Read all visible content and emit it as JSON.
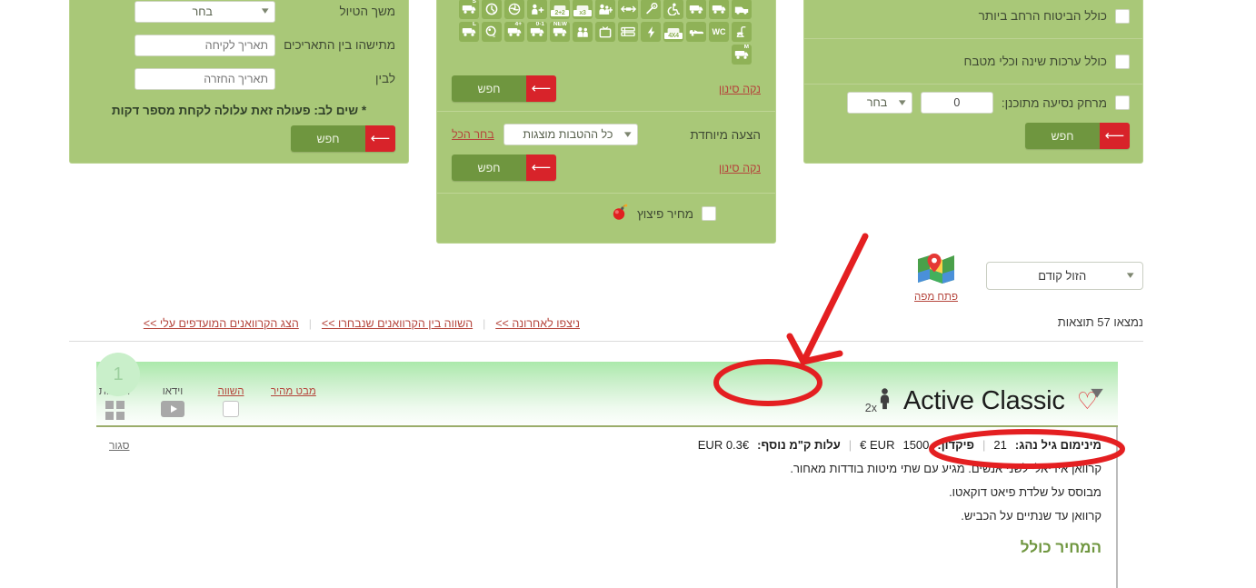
{
  "filters_left": {
    "rows": [
      {
        "label": "משך הטיול",
        "type": "select",
        "value": "בחר"
      },
      {
        "label": "מתישהו בין התאריכים",
        "type": "text",
        "placeholder": "תאריך לקיחה",
        "value": ""
      },
      {
        "label": "לבין",
        "type": "text",
        "placeholder": "תאריך החזרה",
        "value": ""
      }
    ],
    "note": "* שים לב: פעולה זאת עלולה לקחת מספר דקות",
    "search_label": "חפש"
  },
  "filters_mid": {
    "icons": [
      {
        "name": "van-icon",
        "glyph": "van"
      },
      {
        "name": "camper-icon",
        "glyph": "camper"
      },
      {
        "name": "motorhome-icon",
        "glyph": "camper"
      },
      {
        "name": "wheelchair-accessible-icon",
        "glyph": "wheelchair"
      },
      {
        "name": "automatic-transmission-icon",
        "glyph": "key-a"
      },
      {
        "name": "length-icon",
        "glyph": "arrows"
      },
      {
        "name": "family-plus-icon",
        "glyph": "family"
      },
      {
        "name": "capacity-3-icon",
        "glyph": "tag",
        "tag": "x3"
      },
      {
        "name": "capacity-2plus2-icon",
        "glyph": "tag",
        "tag": "2+2"
      },
      {
        "name": "pet-friendly-icon",
        "glyph": "pet"
      },
      {
        "name": "aircon-icon",
        "glyph": "fan"
      },
      {
        "name": "year-icon",
        "glyph": "year"
      },
      {
        "name": "camper-s-icon",
        "glyph": "camper",
        "sup": "S"
      },
      {
        "name": "shower-icon",
        "glyph": "shower"
      },
      {
        "name": "toilet-icon",
        "glyph": "wc"
      },
      {
        "name": "bed-van-icon",
        "glyph": "bedvan"
      },
      {
        "name": "four-by-four-icon",
        "glyph": "tag",
        "tag": "4X4"
      },
      {
        "name": "electricity-icon",
        "glyph": "bolt"
      },
      {
        "name": "bunk-bed-icon",
        "glyph": "bunk"
      },
      {
        "name": "tv-icon",
        "glyph": "tv"
      },
      {
        "name": "children-icon",
        "glyph": "kids"
      },
      {
        "name": "new-camper-icon",
        "glyph": "camper",
        "sup": "NEW"
      },
      {
        "name": "camper-0-1-icon",
        "glyph": "camper",
        "sup": "0-1"
      },
      {
        "name": "camper-plus4-icon",
        "glyph": "camper",
        "sup": "+4"
      },
      {
        "name": "celsius-icon",
        "glyph": "celsius"
      },
      {
        "name": "camper-l-icon",
        "glyph": "camper",
        "sup": "L"
      },
      {
        "name": "camper-m-icon",
        "glyph": "camper",
        "sup": "M"
      }
    ],
    "clear_filter_1": "נקה סינון",
    "search_label_1": "חפש",
    "special_offer_label": "הצעה מיוחדת",
    "offers_select_value": "כל ההטבות מוצגות",
    "select_all": "בחר הכל",
    "clear_filter_2": "נקה סינון",
    "search_label_2": "חפש",
    "blowout_price_label": "מחיר פיצוץ"
  },
  "filters_right": {
    "rows": [
      {
        "label": "כולל הביטוח הרחב ביותר"
      },
      {
        "label": "כולל ערכות שינה וכלי מטבח"
      }
    ],
    "distance_label": "מרחק נסיעה מתוכנן:",
    "distance_value": "0",
    "distance_unit": "בחר",
    "search_label": "חפש"
  },
  "toolbar": {
    "sort_value": "הזול קודם",
    "map_label": "פתח מפה",
    "results_count": "נמצאו 57 תוצאות",
    "links": [
      "ניצפו לאחרונה >>",
      "השווה בין הקרוואנים שנבחרו >>",
      "הצג הקרוואנים המועדפים עלי >>"
    ]
  },
  "result_card": {
    "badge": "1",
    "name": "Active Classic",
    "sleeps": "2x",
    "quick_view": "מבט מהיר",
    "compare": "השווה",
    "video": "וידאו",
    "photos": "תמונות",
    "close_link": "סגור",
    "specs": {
      "min_age_label": "מינימום גיל נהג:",
      "min_age_value": "21",
      "deposit_label": "פיקדון:",
      "deposit_value": "1500",
      "deposit_currency": "EUR €",
      "extra_km_label": "עלות ק\"מ נוסף:",
      "extra_km_value": "EUR 0.3€"
    },
    "description": [
      "קרוואן אידיאלי לשני אנשים. מגיע עם שתי מיטות בודדות מאחור.",
      "מבוסס על שלדת פיאט דוקאטו.",
      "קרוואן עד שנתיים על הכביש."
    ],
    "price_includes_heading": "המחיר כולל"
  },
  "colors": {
    "panel_green": "#a9c878",
    "icon_green": "#8fb257",
    "button_green": "#6f963f",
    "button_red": "#d8232a",
    "link_red": "#b5453c",
    "annotation_red": "#e41f21",
    "card_head_green": "#abe9ab",
    "heading_green": "#6f963f"
  }
}
